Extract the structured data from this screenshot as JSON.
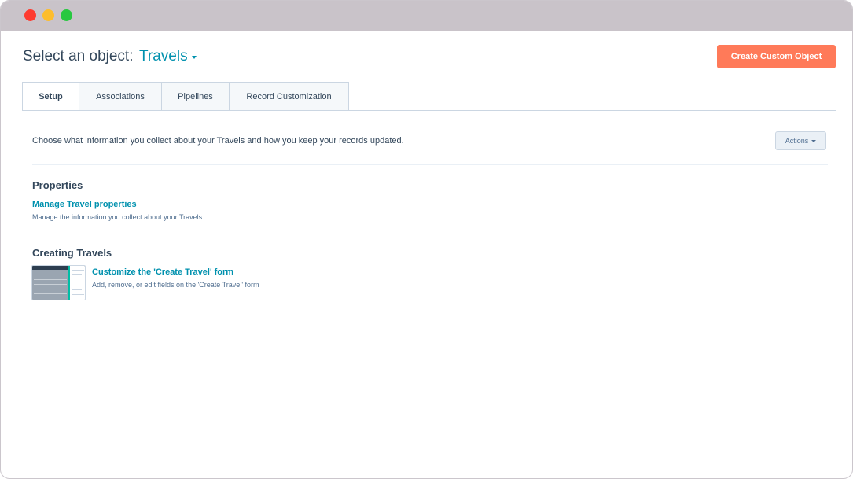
{
  "window": {
    "controls": [
      "close",
      "minimize",
      "maximize"
    ]
  },
  "header": {
    "label": "Select an object:",
    "selected_object": "Travels",
    "create_button": "Create Custom Object"
  },
  "tabs": [
    {
      "label": "Setup",
      "active": true
    },
    {
      "label": "Associations",
      "active": false
    },
    {
      "label": "Pipelines",
      "active": false
    },
    {
      "label": "Record Customization",
      "active": false
    }
  ],
  "setup": {
    "intro": "Choose what information you collect about your Travels and how you keep your records updated.",
    "actions_button": "Actions",
    "properties": {
      "title": "Properties",
      "link": "Manage Travel properties",
      "description": "Manage the information you collect about your Travels."
    },
    "creating": {
      "title": "Creating Travels",
      "link": "Customize the 'Create Travel' form",
      "description": "Add, remove, or edit fields on the 'Create Travel' form"
    }
  },
  "colors": {
    "accent": "#0091ae",
    "primary_button": "#ff7a59",
    "text": "#33475b"
  }
}
